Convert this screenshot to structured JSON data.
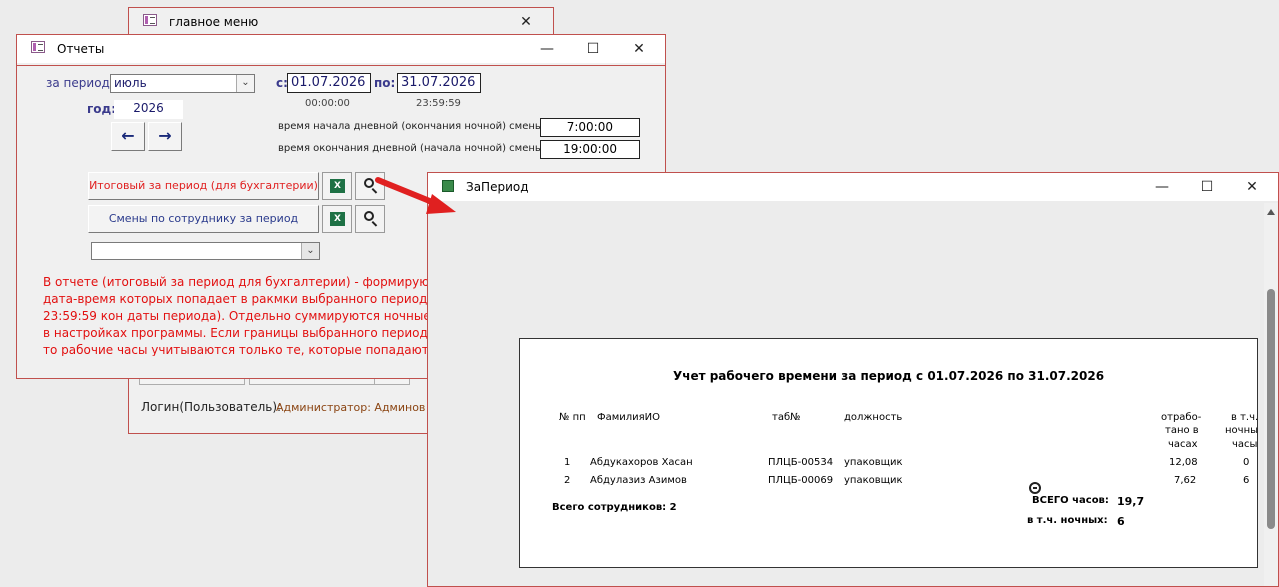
{
  "main_menu": {
    "title": "главное меню",
    "login_label": "Логин(Пользователь):",
    "login_value": "Администратор: Админов А.А."
  },
  "reports": {
    "title": "Отчеты",
    "period_label": "за период:",
    "period_value": "июль",
    "from_label": "с:",
    "from_date": "01.07.2026",
    "to_label": "по:",
    "to_date": "31.07.2026",
    "from_time": "00:00:00",
    "to_time": "23:59:59",
    "year_label": "год:",
    "year_value": "2026",
    "prev_arrow": "←",
    "next_arrow": "→",
    "day_start_label": "время начала дневной (окончания ночной) смены:",
    "day_start_value": "7:00:00",
    "day_end_label": "время окончания дневной (начала ночной) смены:",
    "day_end_value": "19:00:00",
    "btn_total": "Итоговый за период (для бухгалтерии)",
    "btn_shifts": "Смены по сотруднику за период",
    "employee_select": "",
    "message": "В отчете (итоговый за период для бухгалтерии) - формируются д\nдата-время которых попадает в ракмки выбранного периода (с 0\n23:59:59 кон даты периода). Отдельно суммируются ночные час\nв настройках программы. Если границы выбранного периода раз\nто рабочие часы учитываются только те, которые попадают в р"
  },
  "preview": {
    "title": "ЗаПериод",
    "report_title": "Учет рабочего времени за период с 01.07.2026 по 31.07.2026",
    "columns": {
      "num": "№ пп",
      "fio": "ФамилияИО",
      "tab": "таб№",
      "position": "должность",
      "worked_1": "отрабо-",
      "worked_2": "тано в",
      "worked_3": "часах",
      "night_1": "в т.ч.",
      "night_2": "ночны",
      "night_3": "часы"
    },
    "rows": [
      {
        "num": "1",
        "fio": "Абдукахоров Хасан",
        "tab": "ПЛЦБ-00534",
        "position": "упаковщик",
        "hours": "12,08",
        "night": "0"
      },
      {
        "num": "2",
        "fio": "Абдулазиз Азимов",
        "tab": "ПЛЦБ-00069",
        "position": "упаковщик",
        "hours": "7,62",
        "night": "6"
      }
    ],
    "total_employees": "Всего сотрудников: 2",
    "total_hours_label": "ВСЕГО часов:",
    "total_hours_value": "19,7",
    "night_total_label": "в т.ч. ночных:",
    "night_total_value": "6"
  },
  "colors": {
    "border_red": "#c0504d",
    "label_blue": "#3a3a8c",
    "message_red": "#e21010",
    "arrow_red": "#e02020"
  }
}
